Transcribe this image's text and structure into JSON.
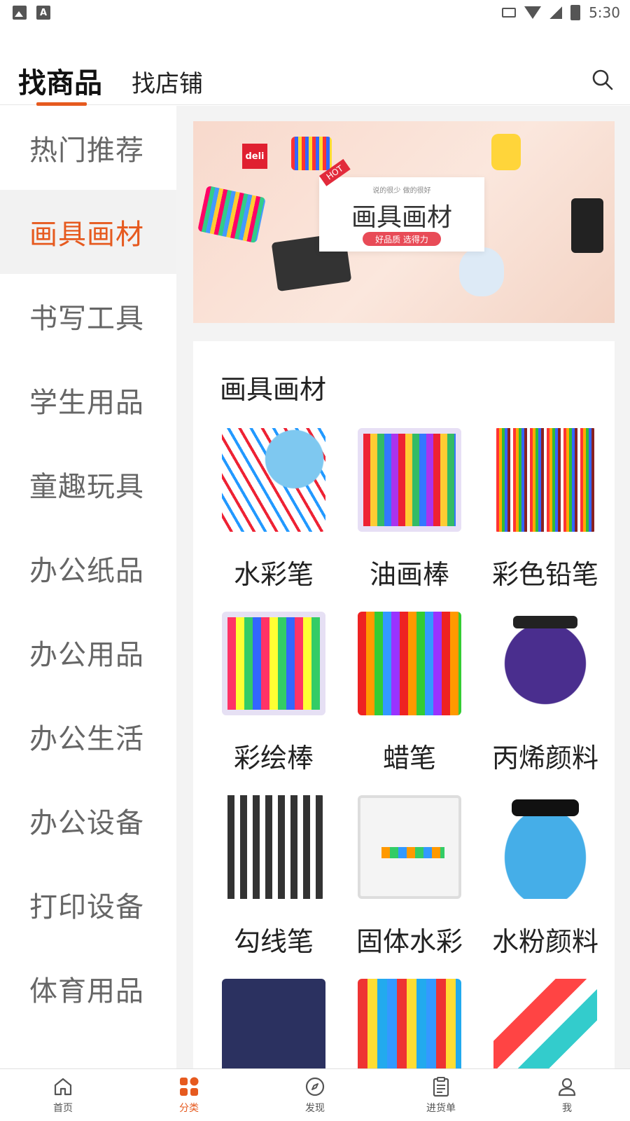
{
  "status_bar": {
    "time": "5:30"
  },
  "tabs": {
    "goods": "找商品",
    "shops": "找店铺"
  },
  "sidebar": {
    "items": [
      {
        "label": "热门推荐",
        "active": false
      },
      {
        "label": "画具画材",
        "active": true
      },
      {
        "label": "书写工具",
        "active": false
      },
      {
        "label": "学生用品",
        "active": false
      },
      {
        "label": "童趣玩具",
        "active": false
      },
      {
        "label": "办公纸品",
        "active": false
      },
      {
        "label": "办公用品",
        "active": false
      },
      {
        "label": "办公生活",
        "active": false
      },
      {
        "label": "办公设备",
        "active": false
      },
      {
        "label": "打印设备",
        "active": false
      },
      {
        "label": "体育用品",
        "active": false
      }
    ]
  },
  "banner": {
    "brand": "deli",
    "hot": "HOT",
    "subtitle": "说的很少 做的很好",
    "title": "画具画材",
    "pill": "好品质 选得力"
  },
  "category": {
    "title": "画具画材",
    "items": [
      {
        "label": "水彩笔"
      },
      {
        "label": "油画棒"
      },
      {
        "label": "彩色铅笔"
      },
      {
        "label": "彩绘棒"
      },
      {
        "label": "蜡笔"
      },
      {
        "label": "丙烯颜料"
      },
      {
        "label": "勾线笔"
      },
      {
        "label": "固体水彩"
      },
      {
        "label": "水粉颜料"
      },
      {
        "label": ""
      },
      {
        "label": ""
      },
      {
        "label": ""
      }
    ]
  },
  "bottom_nav": {
    "items": [
      {
        "label": "首页",
        "icon": "home-icon",
        "active": false
      },
      {
        "label": "分类",
        "icon": "category-icon",
        "active": true
      },
      {
        "label": "发现",
        "icon": "compass-icon",
        "active": false
      },
      {
        "label": "进货单",
        "icon": "clipboard-icon",
        "active": false
      },
      {
        "label": "我",
        "icon": "user-icon",
        "active": false
      }
    ]
  },
  "colors": {
    "accent": "#e65a1f",
    "sidebar_active_bg": "#f2f2f2",
    "main_bg": "#f3f3f3"
  }
}
